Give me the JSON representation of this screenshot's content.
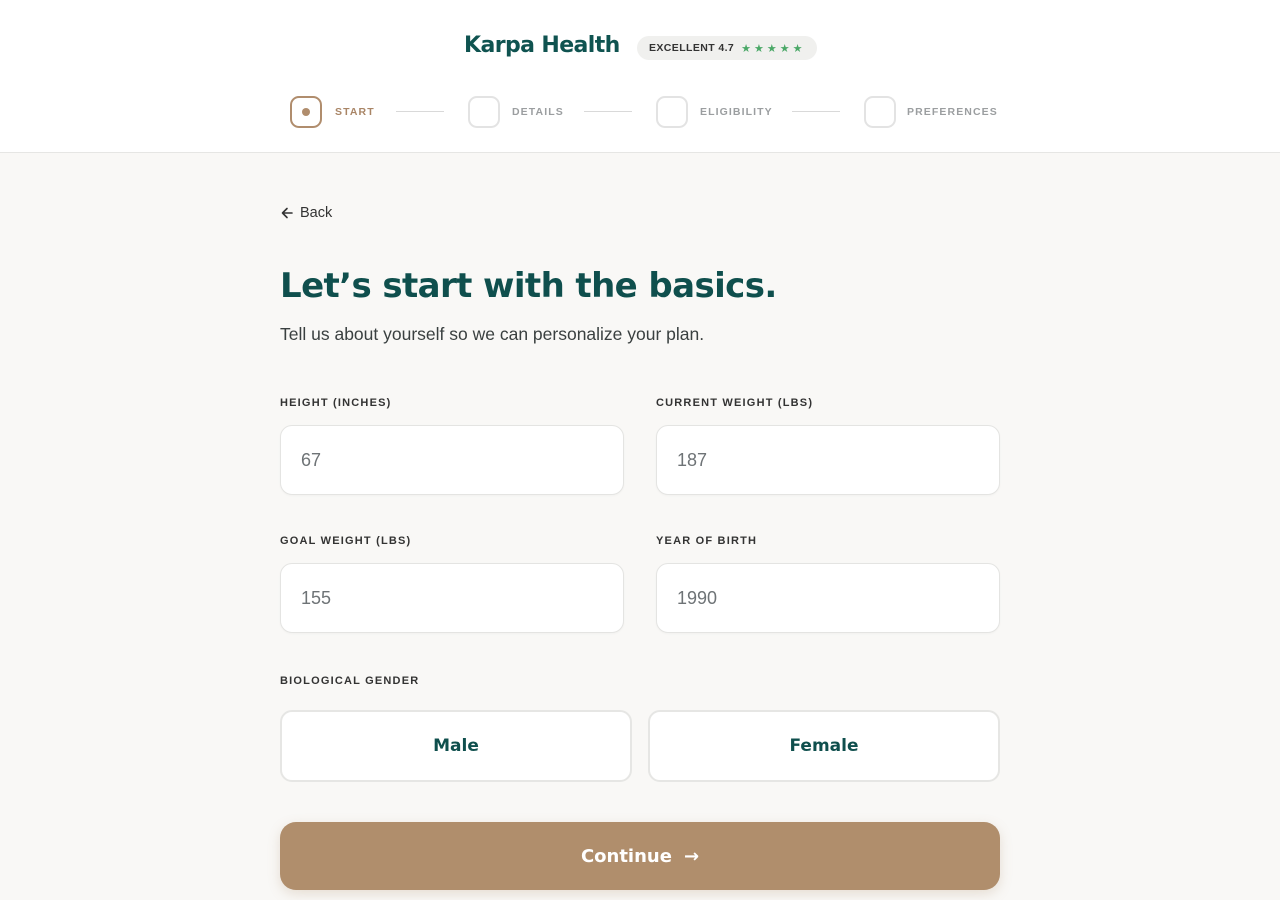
{
  "header": {
    "brand": "Karpa Health",
    "rating_text": "EXCELLENT 4.7",
    "rating_stars": "★★★★★"
  },
  "stepper": {
    "steps": [
      {
        "label": "START",
        "active": true
      },
      {
        "label": "DETAILS",
        "active": false
      },
      {
        "label": "ELIGIBILITY",
        "active": false
      },
      {
        "label": "PREFERENCES",
        "active": false
      }
    ]
  },
  "nav": {
    "back_label": "Back"
  },
  "page": {
    "title": "Let’s start with the basics.",
    "subtitle": "Tell us about yourself so we can personalize your plan."
  },
  "form": {
    "height": {
      "label": "HEIGHT (INCHES)",
      "placeholder": "67"
    },
    "current_weight": {
      "label": "CURRENT WEIGHT (LBS)",
      "placeholder": "187"
    },
    "goal_weight": {
      "label": "GOAL WEIGHT (LBS)",
      "placeholder": "155"
    },
    "year_of_birth": {
      "label": "YEAR OF BIRTH",
      "placeholder": "1990"
    },
    "gender": {
      "label": "BIOLOGICAL GENDER",
      "options": [
        "Male",
        "Female"
      ]
    },
    "continue_label": "Continue",
    "continue_arrow": "→"
  },
  "colors": {
    "brand": "#0f5350",
    "accent": "#b08e6c",
    "background": "#f9f8f6"
  }
}
